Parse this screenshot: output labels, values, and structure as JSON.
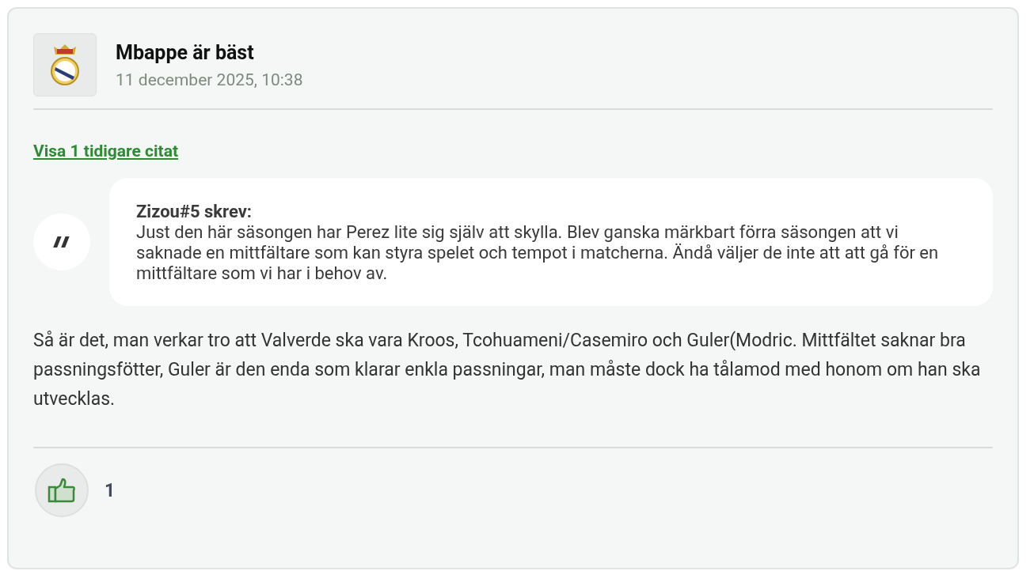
{
  "post": {
    "author": "Mbappe är bäst",
    "timestamp": "11 december 2025, 10:38",
    "earlier_quotes_link": "Visa 1 tidigare citat",
    "quote": {
      "header": "Zizou#5 skrev:",
      "text": "Just den här säsongen har Perez lite sig själv att skylla. Blev ganska märkbart förra säsongen att vi saknade en mittfältare som kan styra spelet och tempot i matcherna. Ändå väljer de inte att att gå för en mittfältare som vi har i behov av."
    },
    "body": "Så är det, man verkar tro att Valverde ska vara Kroos, Tcohuameni/Casemiro och Guler(Modric. Mittfältet saknar bra passningsfötter, Guler är den enda som klarar enkla passningar, man måste dock ha tålamod med honom om han ska utvecklas.",
    "likes": {
      "count": "1"
    }
  }
}
